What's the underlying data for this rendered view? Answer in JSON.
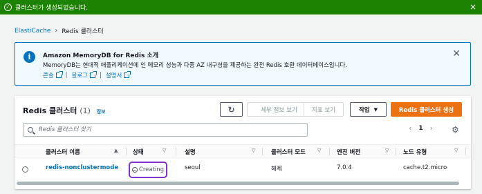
{
  "flash": {
    "message": "클러스터가 생성되었습니다."
  },
  "breadcrumb": {
    "root": "ElastiCache",
    "current": "Redis 클러스터"
  },
  "info": {
    "title": "Amazon MemoryDB for Redis 소개",
    "description": "MemoryDB는 현대적 애플리케이션에 인 메모리 성능과 다중 AZ 내구성을 제공하는 완전 Redis 호환 데이터베이스입니다.",
    "links": [
      "콘솔",
      "블로그",
      "설명서"
    ]
  },
  "panel": {
    "title": "Redis 클러스터",
    "count": "(1)",
    "info_link": "정보",
    "buttons": {
      "details": "세부 정보 보기",
      "metrics": "지표 보기",
      "actions": "작업",
      "create": "Redis 클러스터 생성"
    },
    "search_placeholder": "Redis 클러스터 찾기",
    "pagination": {
      "page": "1"
    },
    "columns": [
      "클러스터 이름",
      "상태",
      "설명",
      "클러스터 모드",
      "엔진 버전",
      "노드 유형"
    ],
    "rows": [
      {
        "name": "redis-nonclustermode",
        "status": "Creating",
        "description": "seoul",
        "cluster_mode": "해제",
        "engine_version": "7.0.4",
        "node_type": "cache.t2.micro"
      }
    ]
  },
  "colors": {
    "success": "#1d8102",
    "link": "#0073bb",
    "primary": "#ec7211",
    "highlight": "#7d33cc"
  }
}
